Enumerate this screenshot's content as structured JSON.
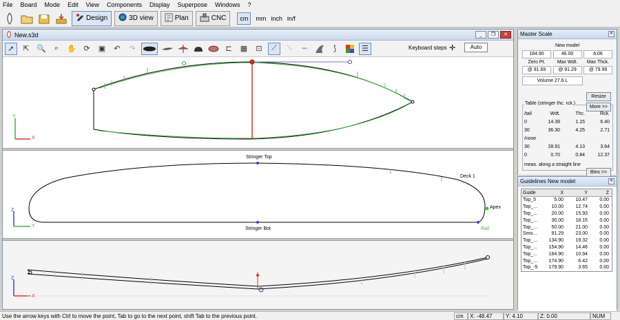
{
  "menu": [
    "File",
    "Board",
    "Mode",
    "Edit",
    "View",
    "Components",
    "Display",
    "Superpose",
    "Windows",
    "?"
  ],
  "toolbar": {
    "design_label": "Design",
    "view3d_label": "3D view",
    "plan_label": "Plan",
    "cnc_label": "CNC",
    "units": [
      "cm",
      "mm",
      "inch",
      "in/f"
    ],
    "active_unit": "cm"
  },
  "document": {
    "title": "New.s3d",
    "keyboard_steps_label": "Keyboard steps",
    "auto_label": "Auto"
  },
  "views": {
    "top_axes": {
      "y": "Y",
      "x": "X"
    },
    "side_axes": {
      "z": "Z",
      "y": "Y"
    },
    "section_axes": {
      "z": "Z",
      "x": "X"
    },
    "stringer_top": "Stringer Top",
    "stringer_bot": "Stringer Bot",
    "deck_label": "Deck 1",
    "apex_label": "Apex",
    "rail_label": "Rail"
  },
  "master_scale": {
    "title": "Master Scale",
    "model_name": "New model",
    "values": [
      "184.90",
      "46.00",
      "6.06"
    ],
    "labels": [
      "Zero Pt.",
      "Max Wdt.",
      "Max Thck."
    ],
    "positions": [
      "@ 91.69",
      "@ 91.29",
      "@ 79.99"
    ],
    "volume": "Volume  27.6 L",
    "resize_label": "Resize",
    "more_label": "More >>",
    "table_label": "Table (stringer thc. rck.)",
    "table_head": [
      "/tail",
      "Wdt.",
      "Thc.",
      "Rck."
    ],
    "tail_rows": [
      [
        "0",
        "14.39",
        "1.15",
        "6.40"
      ],
      [
        "30",
        "36.30",
        "4.25",
        "2.71"
      ]
    ],
    "nose_label": "/nose",
    "nose_rows": [
      [
        "30",
        "28.91",
        "4.13",
        "3.64"
      ],
      [
        "0",
        "0.70",
        "0.84",
        "12.37"
      ]
    ],
    "meas_note": "meas. along a straight line",
    "btns_label": "Btns >>"
  },
  "guidelines": {
    "title": "Guidelines New model",
    "columns": [
      "Guide",
      "X",
      "Y",
      "Z"
    ],
    "rows": [
      [
        "Top_5",
        "5.00",
        "10.47",
        "0.00"
      ],
      [
        "Top_...",
        "10.00",
        "12.74",
        "0.00"
      ],
      [
        "Top_...",
        "20.00",
        "15.93",
        "0.00"
      ],
      [
        "Top_...",
        "30.00",
        "18.15",
        "0.00"
      ],
      [
        "Top_...",
        "50.00",
        "21.00",
        "0.00"
      ],
      [
        "Smo...",
        "91.29",
        "23.00",
        "0.00"
      ],
      [
        "Top_...",
        "134.90",
        "19.32",
        "0.00"
      ],
      [
        "Top_...",
        "154.90",
        "14.46",
        "0.00"
      ],
      [
        "Top_...",
        "164.90",
        "10.94",
        "0.00"
      ],
      [
        "Top_...",
        "174.90",
        "6.42",
        "0.00"
      ],
      [
        "Top_-5",
        "179.90",
        "3.65",
        "0.00"
      ]
    ]
  },
  "status": {
    "message": "Use the arrow keys with Ctrl to move the point, Tab to go to the next point, shift Tab to the previous point.",
    "unit": "cm",
    "x": "X: -48.47",
    "y": "Y: 4.10",
    "z": "Z: 0.00",
    "num": "NUM"
  }
}
